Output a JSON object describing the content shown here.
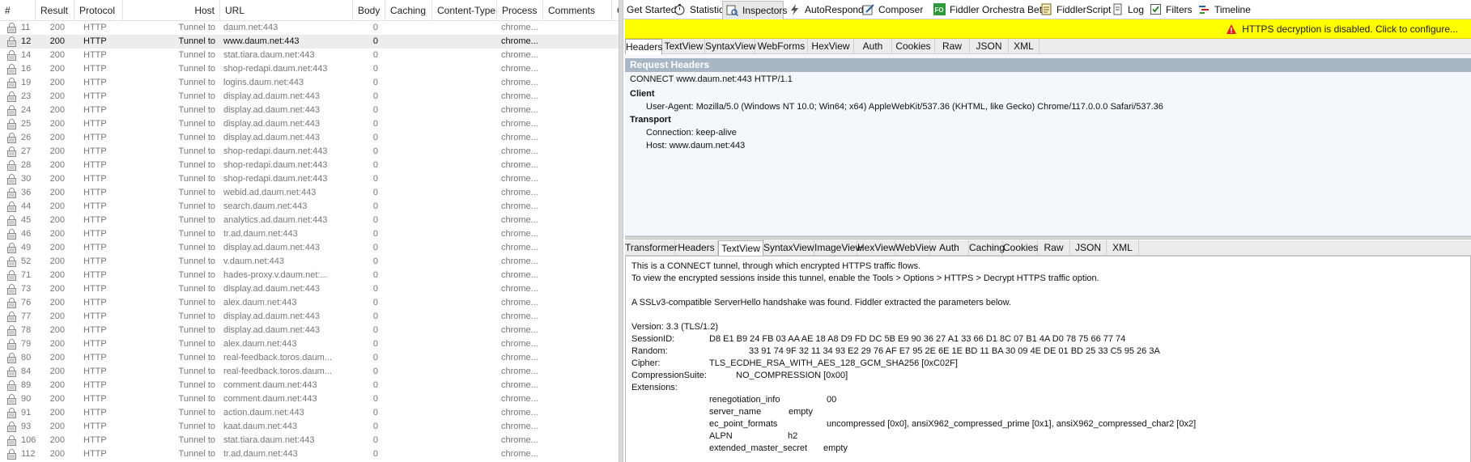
{
  "columns": [
    "#",
    "Result",
    "Protocol",
    "Host",
    "URL",
    "Body",
    "Caching",
    "Content-Type",
    "Process",
    "Comments",
    "C"
  ],
  "sessions": [
    {
      "num": "11",
      "result": "200",
      "protocol": "HTTP",
      "host": "Tunnel to",
      "url": "daum.net:443",
      "body": "0",
      "process": "chrome..."
    },
    {
      "num": "12",
      "result": "200",
      "protocol": "HTTP",
      "host": "Tunnel to",
      "url": "www.daum.net:443",
      "body": "0",
      "process": "chrome...",
      "selected": true
    },
    {
      "num": "14",
      "result": "200",
      "protocol": "HTTP",
      "host": "Tunnel to",
      "url": "stat.tiara.daum.net:443",
      "body": "0",
      "process": "chrome..."
    },
    {
      "num": "16",
      "result": "200",
      "protocol": "HTTP",
      "host": "Tunnel to",
      "url": "shop-redapi.daum.net:443",
      "body": "0",
      "process": "chrome..."
    },
    {
      "num": "19",
      "result": "200",
      "protocol": "HTTP",
      "host": "Tunnel to",
      "url": "logins.daum.net:443",
      "body": "0",
      "process": "chrome..."
    },
    {
      "num": "23",
      "result": "200",
      "protocol": "HTTP",
      "host": "Tunnel to",
      "url": "display.ad.daum.net:443",
      "body": "0",
      "process": "chrome..."
    },
    {
      "num": "24",
      "result": "200",
      "protocol": "HTTP",
      "host": "Tunnel to",
      "url": "display.ad.daum.net:443",
      "body": "0",
      "process": "chrome..."
    },
    {
      "num": "25",
      "result": "200",
      "protocol": "HTTP",
      "host": "Tunnel to",
      "url": "display.ad.daum.net:443",
      "body": "0",
      "process": "chrome..."
    },
    {
      "num": "26",
      "result": "200",
      "protocol": "HTTP",
      "host": "Tunnel to",
      "url": "display.ad.daum.net:443",
      "body": "0",
      "process": "chrome..."
    },
    {
      "num": "27",
      "result": "200",
      "protocol": "HTTP",
      "host": "Tunnel to",
      "url": "shop-redapi.daum.net:443",
      "body": "0",
      "process": "chrome..."
    },
    {
      "num": "28",
      "result": "200",
      "protocol": "HTTP",
      "host": "Tunnel to",
      "url": "shop-redapi.daum.net:443",
      "body": "0",
      "process": "chrome..."
    },
    {
      "num": "30",
      "result": "200",
      "protocol": "HTTP",
      "host": "Tunnel to",
      "url": "shop-redapi.daum.net:443",
      "body": "0",
      "process": "chrome..."
    },
    {
      "num": "36",
      "result": "200",
      "protocol": "HTTP",
      "host": "Tunnel to",
      "url": "webid.ad.daum.net:443",
      "body": "0",
      "process": "chrome..."
    },
    {
      "num": "44",
      "result": "200",
      "protocol": "HTTP",
      "host": "Tunnel to",
      "url": "search.daum.net:443",
      "body": "0",
      "process": "chrome..."
    },
    {
      "num": "45",
      "result": "200",
      "protocol": "HTTP",
      "host": "Tunnel to",
      "url": "analytics.ad.daum.net:443",
      "body": "0",
      "process": "chrome..."
    },
    {
      "num": "46",
      "result": "200",
      "protocol": "HTTP",
      "host": "Tunnel to",
      "url": "tr.ad.daum.net:443",
      "body": "0",
      "process": "chrome..."
    },
    {
      "num": "49",
      "result": "200",
      "protocol": "HTTP",
      "host": "Tunnel to",
      "url": "display.ad.daum.net:443",
      "body": "0",
      "process": "chrome..."
    },
    {
      "num": "52",
      "result": "200",
      "protocol": "HTTP",
      "host": "Tunnel to",
      "url": "v.daum.net:443",
      "body": "0",
      "process": "chrome..."
    },
    {
      "num": "71",
      "result": "200",
      "protocol": "HTTP",
      "host": "Tunnel to",
      "url": "hades-proxy.v.daum.net:...",
      "body": "0",
      "process": "chrome..."
    },
    {
      "num": "73",
      "result": "200",
      "protocol": "HTTP",
      "host": "Tunnel to",
      "url": "display.ad.daum.net:443",
      "body": "0",
      "process": "chrome..."
    },
    {
      "num": "76",
      "result": "200",
      "protocol": "HTTP",
      "host": "Tunnel to",
      "url": "alex.daum.net:443",
      "body": "0",
      "process": "chrome..."
    },
    {
      "num": "77",
      "result": "200",
      "protocol": "HTTP",
      "host": "Tunnel to",
      "url": "display.ad.daum.net:443",
      "body": "0",
      "process": "chrome..."
    },
    {
      "num": "78",
      "result": "200",
      "protocol": "HTTP",
      "host": "Tunnel to",
      "url": "display.ad.daum.net:443",
      "body": "0",
      "process": "chrome..."
    },
    {
      "num": "79",
      "result": "200",
      "protocol": "HTTP",
      "host": "Tunnel to",
      "url": "alex.daum.net:443",
      "body": "0",
      "process": "chrome..."
    },
    {
      "num": "80",
      "result": "200",
      "protocol": "HTTP",
      "host": "Tunnel to",
      "url": "real-feedback.toros.daum...",
      "body": "0",
      "process": "chrome..."
    },
    {
      "num": "84",
      "result": "200",
      "protocol": "HTTP",
      "host": "Tunnel to",
      "url": "real-feedback.toros.daum...",
      "body": "0",
      "process": "chrome..."
    },
    {
      "num": "89",
      "result": "200",
      "protocol": "HTTP",
      "host": "Tunnel to",
      "url": "comment.daum.net:443",
      "body": "0",
      "process": "chrome..."
    },
    {
      "num": "90",
      "result": "200",
      "protocol": "HTTP",
      "host": "Tunnel to",
      "url": "comment.daum.net:443",
      "body": "0",
      "process": "chrome..."
    },
    {
      "num": "91",
      "result": "200",
      "protocol": "HTTP",
      "host": "Tunnel to",
      "url": "action.daum.net:443",
      "body": "0",
      "process": "chrome..."
    },
    {
      "num": "93",
      "result": "200",
      "protocol": "HTTP",
      "host": "Tunnel to",
      "url": "kaat.daum.net:443",
      "body": "0",
      "process": "chrome..."
    },
    {
      "num": "106",
      "result": "200",
      "protocol": "HTTP",
      "host": "Tunnel to",
      "url": "stat.tiara.daum.net:443",
      "body": "0",
      "process": "chrome..."
    },
    {
      "num": "112",
      "result": "200",
      "protocol": "HTTP",
      "host": "Tunnel to",
      "url": "tr.ad.daum.net:443",
      "body": "0",
      "process": "chrome..."
    }
  ],
  "top_tabs": [
    {
      "label": "Get Started",
      "icon": "none"
    },
    {
      "label": "Statistics",
      "icon": "stopwatch-icon"
    },
    {
      "label": "Inspectors",
      "icon": "inspector-icon",
      "active": true
    },
    {
      "label": "AutoResponder",
      "icon": "lightning-icon"
    },
    {
      "label": "Composer",
      "icon": "composer-icon"
    },
    {
      "label": "Fiddler Orchestra Beta",
      "icon": "fo-icon"
    },
    {
      "label": "FiddlerScript",
      "icon": "script-icon"
    },
    {
      "label": "Log",
      "icon": "log-icon"
    },
    {
      "label": "Filters",
      "icon": "checkbox-icon"
    },
    {
      "label": "Timeline",
      "icon": "timeline-icon"
    }
  ],
  "warning": {
    "text": "HTTPS decryption is disabled. Click to configure...",
    "icon": "warning-icon"
  },
  "request_tabs": [
    "Headers",
    "TextView",
    "SyntaxView",
    "WebForms",
    "HexView",
    "Auth",
    "Cookies",
    "Raw",
    "JSON",
    "XML"
  ],
  "request_active": "Headers",
  "request_headers": {
    "title": "Request Headers",
    "request_line": "CONNECT www.daum.net:443 HTTP/1.1",
    "groups": [
      {
        "name": "Client",
        "items": [
          "User-Agent: Mozilla/5.0 (Windows NT 10.0; Win64; x64) AppleWebKit/537.36 (KHTML, like Gecko) Chrome/117.0.0.0 Safari/537.36"
        ]
      },
      {
        "name": "Transport",
        "items": [
          "Connection: keep-alive",
          "Host: www.daum.net:443"
        ]
      }
    ]
  },
  "response_tabs": [
    "Transformer",
    "Headers",
    "TextView",
    "SyntaxView",
    "ImageView",
    "HexView",
    "WebView",
    "Auth",
    "Caching",
    "Cookies",
    "Raw",
    "JSON",
    "XML"
  ],
  "response_active": "TextView",
  "response_text": {
    "line1": "This is a CONNECT tunnel, through which encrypted HTTPS traffic flows.",
    "line2": "To view the encrypted sessions inside this tunnel, enable the Tools > Options > HTTPS > Decrypt HTTPS traffic option.",
    "line3": "A SSLv3-compatible ServerHello handshake was found. Fiddler extracted the parameters below.",
    "version": "Version: 3.3 (TLS/1.2)",
    "sessionid_label": "SessionID:",
    "sessionid_value": "D8 E1 B9 24 FB 03 AA AE 18 A8 D9 FD DC 5B E9 90 36 27 A1 33 66 D1 8C 07 B1 4A D0 78 75 66 77 74",
    "random_label": "Random:",
    "random_value": "33 91 74 9F 32 11 34 93 E2 29 76 AF E7 95 2E 6E 1E BD 11 BA 30 09 4E DE 01 BD 25 33 C5 95 26 3A",
    "cipher_label": "Cipher:",
    "cipher_value": "TLS_ECDHE_RSA_WITH_AES_128_GCM_SHA256 [0xC02F]",
    "compression_label": "CompressionSuite:",
    "compression_value": "NO_COMPRESSION [0x00]",
    "extensions_label": "Extensions:",
    "extensions": [
      {
        "name": "renegotiation_info",
        "value": "00"
      },
      {
        "name": "server_name",
        "value": "empty"
      },
      {
        "name": "ec_point_formats",
        "value": "uncompressed [0x0], ansiX962_compressed_prime [0x1], ansiX962_compressed_char2 [0x2]"
      },
      {
        "name": "ALPN",
        "value": "h2"
      },
      {
        "name": "extended_master_secret",
        "value": "empty"
      }
    ]
  },
  "colors": {
    "warning_bar": "#ffff00",
    "header_title_bg": "#a9b6c6",
    "selected_row": "#ededed",
    "row_text": "#777777"
  }
}
